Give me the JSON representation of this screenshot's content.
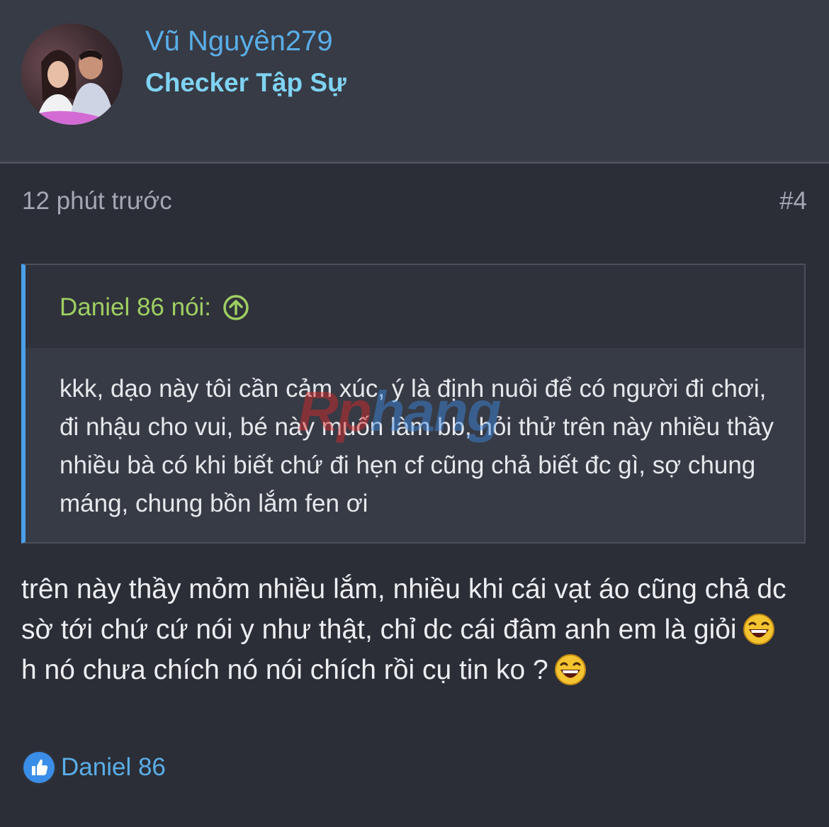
{
  "user": {
    "name": "Vũ Nguyên279",
    "title": "Checker Tập Sự"
  },
  "post": {
    "time": "12 phút trước",
    "number": "#4",
    "quote": {
      "author": "Daniel 86 nói:",
      "text": "kkk, dạo này tôi cần cảm xúc, ý là định nuôi để có người đi chơi, đi nhậu cho vui, bé này muốn làm bb, hỏi thử trên này nhiều thầy nhiều bà có khi biết chứ đi hẹn cf cũng chả biết đc gì, sợ chung máng, chung bồn lắm fen ơi"
    },
    "body_line1": "trên này thầy mỏm nhiều lắm, nhiều khi cái vạt áo cũng chả dc sờ tới chứ cứ nói y như thật, chỉ dc cái đâm anh em là giỏi",
    "body_line2": "h nó chưa chích nó nói chích rồi cụ tin ko ?"
  },
  "reactions": {
    "icon": "like-icon",
    "names": "Daniel 86"
  },
  "watermark": {
    "part1": "Rp",
    "part2": "hang"
  },
  "colors": {
    "background": "#2b2e36",
    "header": "#373b45",
    "username": "#5aaee8",
    "user_title": "#7fd3f2",
    "quote_author": "#9fcf63",
    "quote_border": "#4a9fe7"
  }
}
